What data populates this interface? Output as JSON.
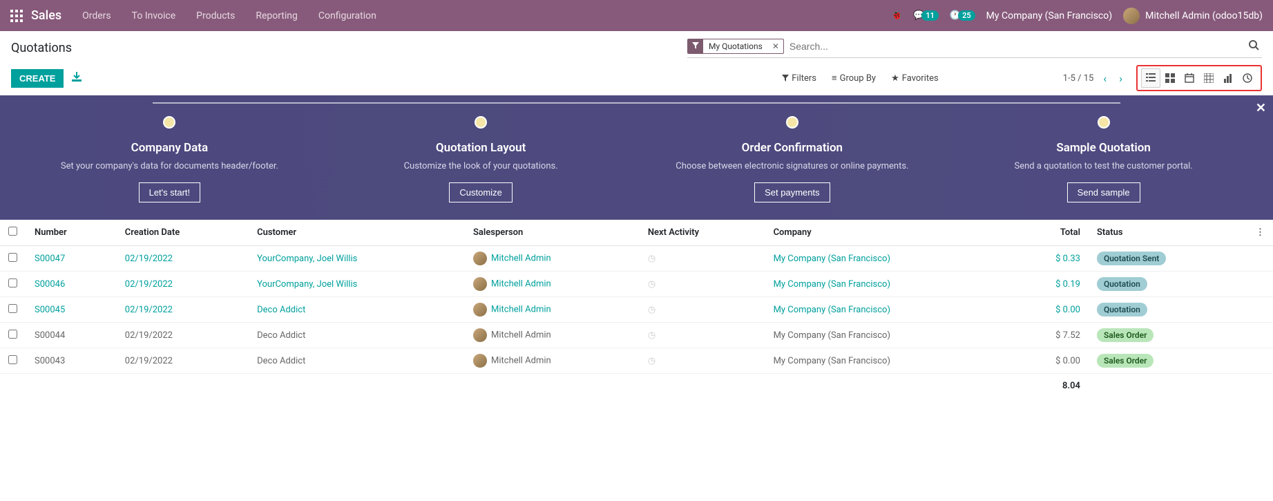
{
  "topbar": {
    "app_title": "Sales",
    "menu": [
      "Orders",
      "To Invoice",
      "Products",
      "Reporting",
      "Configuration"
    ],
    "discuss_badge": "11",
    "activity_badge": "25",
    "company": "My Company (San Francisco)",
    "user": "Mitchell Admin (odoo15db)"
  },
  "control": {
    "breadcrumb": "Quotations",
    "create_label": "CREATE",
    "search_facet": "My Quotations",
    "search_placeholder": "Search...",
    "filters_label": "Filters",
    "groupby_label": "Group By",
    "favorites_label": "Favorites",
    "pager": "1-5 / 15"
  },
  "onboarding": {
    "steps": [
      {
        "title": "Company Data",
        "desc": "Set your company's data for documents header/footer.",
        "btn": "Let's start!"
      },
      {
        "title": "Quotation Layout",
        "desc": "Customize the look of your quotations.",
        "btn": "Customize"
      },
      {
        "title": "Order Confirmation",
        "desc": "Choose between electronic signatures or online payments.",
        "btn": "Set payments"
      },
      {
        "title": "Sample Quotation",
        "desc": "Send a quotation to test the customer portal.",
        "btn": "Send sample"
      }
    ]
  },
  "table": {
    "headers": {
      "number": "Number",
      "creation_date": "Creation Date",
      "customer": "Customer",
      "salesperson": "Salesperson",
      "next_activity": "Next Activity",
      "company": "Company",
      "total": "Total",
      "status": "Status"
    },
    "rows": [
      {
        "number": "S00047",
        "date": "02/19/2022",
        "customer": "YourCompany, Joel Willis",
        "salesperson": "Mitchell Admin",
        "company": "My Company (San Francisco)",
        "total": "$ 0.33",
        "status": "Quotation Sent",
        "status_class": "quotation-sent",
        "linked": true
      },
      {
        "number": "S00046",
        "date": "02/19/2022",
        "customer": "YourCompany, Joel Willis",
        "salesperson": "Mitchell Admin",
        "company": "My Company (San Francisco)",
        "total": "$ 0.19",
        "status": "Quotation",
        "status_class": "quotation",
        "linked": true
      },
      {
        "number": "S00045",
        "date": "02/19/2022",
        "customer": "Deco Addict",
        "salesperson": "Mitchell Admin",
        "company": "My Company (San Francisco)",
        "total": "$ 0.00",
        "status": "Quotation",
        "status_class": "quotation",
        "linked": true
      },
      {
        "number": "S00044",
        "date": "02/19/2022",
        "customer": "Deco Addict",
        "salesperson": "Mitchell Admin",
        "company": "My Company (San Francisco)",
        "total": "$ 7.52",
        "status": "Sales Order",
        "status_class": "sales-order",
        "linked": false
      },
      {
        "number": "S00043",
        "date": "02/19/2022",
        "customer": "Deco Addict",
        "salesperson": "Mitchell Admin",
        "company": "My Company (San Francisco)",
        "total": "$ 0.00",
        "status": "Sales Order",
        "status_class": "sales-order",
        "linked": false
      }
    ],
    "footer_total": "8.04"
  }
}
